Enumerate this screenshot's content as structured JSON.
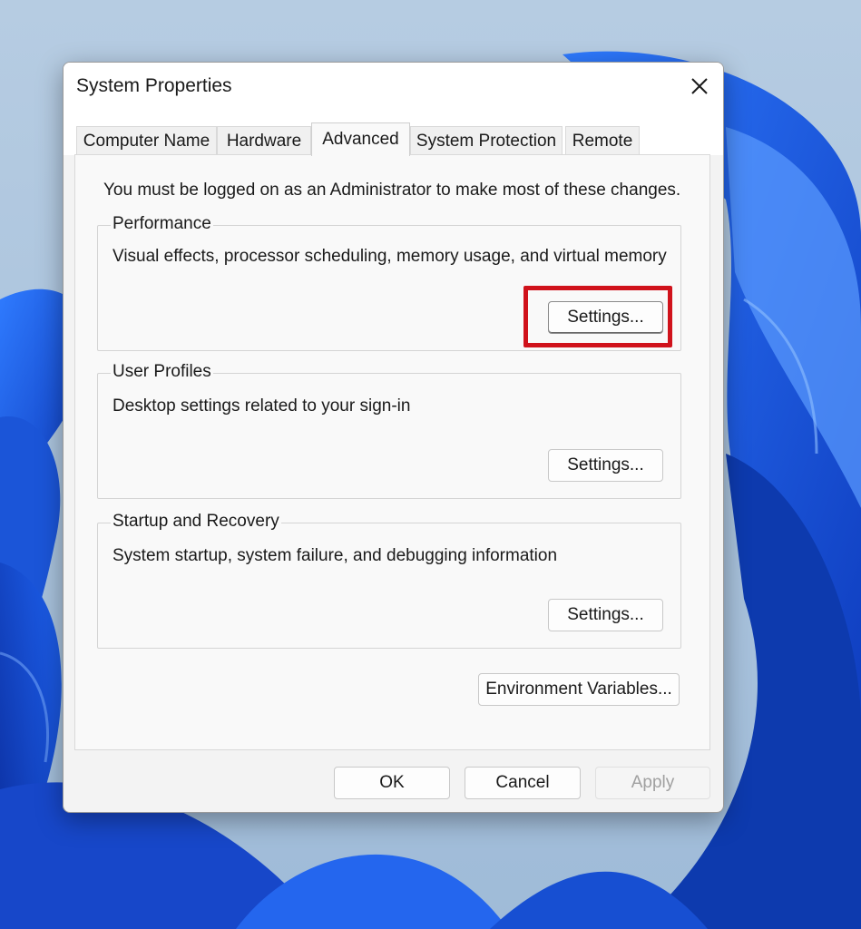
{
  "window": {
    "title": "System Properties"
  },
  "tabs": [
    {
      "label": "Computer Name",
      "active": false
    },
    {
      "label": "Hardware",
      "active": false
    },
    {
      "label": "Advanced",
      "active": true
    },
    {
      "label": "System Protection",
      "active": false
    },
    {
      "label": "Remote",
      "active": false
    }
  ],
  "advanced": {
    "notice": "You must be logged on as an Administrator to make most of these changes.",
    "performance": {
      "label": "Performance",
      "description": "Visual effects, processor scheduling, memory usage, and virtual memory",
      "button": "Settings..."
    },
    "user_profiles": {
      "label": "User Profiles",
      "description": "Desktop settings related to your sign-in",
      "button": "Settings..."
    },
    "startup_recovery": {
      "label": "Startup and Recovery",
      "description": "System startup, system failure, and debugging information",
      "button": "Settings..."
    },
    "env_button": "Environment Variables..."
  },
  "footer": {
    "ok": "OK",
    "cancel": "Cancel",
    "apply": "Apply"
  },
  "colors": {
    "highlight": "#d0121b",
    "wallpaper_blue": "#1f5fe0"
  }
}
